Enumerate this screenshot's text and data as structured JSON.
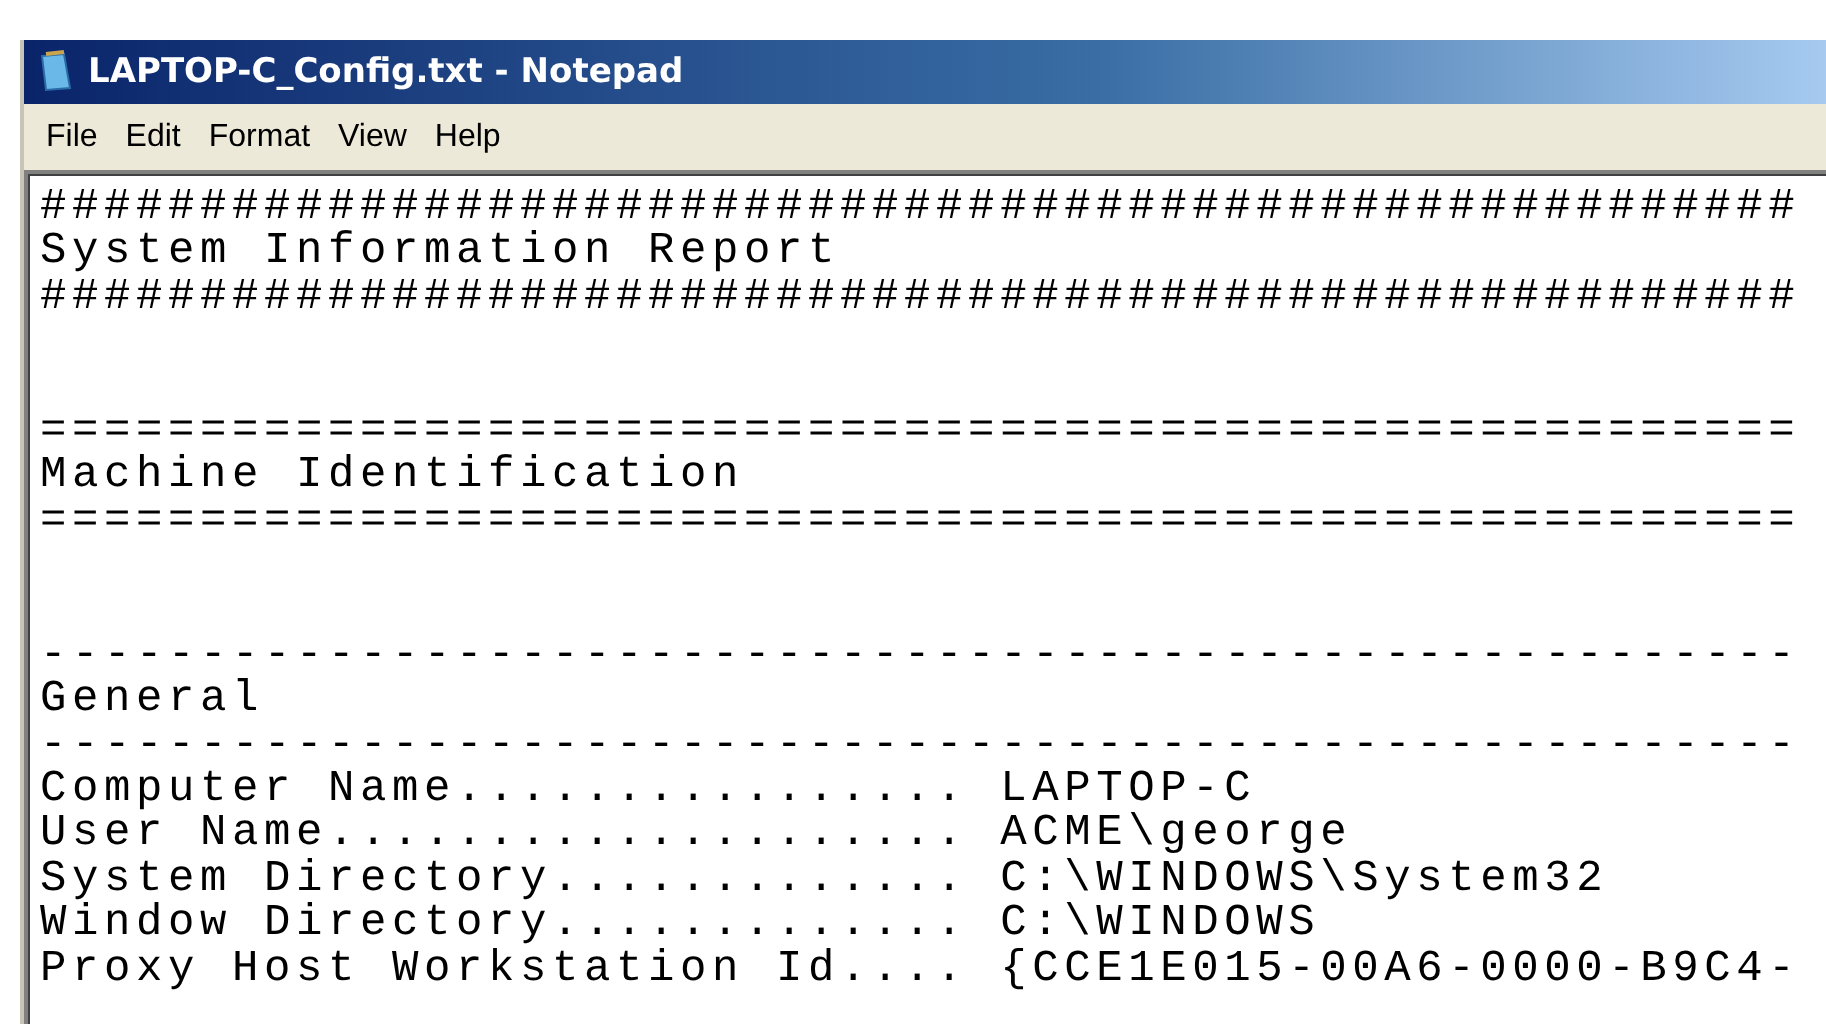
{
  "window": {
    "title": "LAPTOP-C_Config.txt - Notepad"
  },
  "menu": [
    "File",
    "Edit",
    "Format",
    "View",
    "Help"
  ],
  "lines": [
    {
      "kind": "text",
      "text": "#######################################################"
    },
    {
      "kind": "text",
      "text": "System Information Report"
    },
    {
      "kind": "text",
      "text": "#######################################################"
    },
    {
      "kind": "blank"
    },
    {
      "kind": "blank"
    },
    {
      "kind": "text",
      "text": "======================================================="
    },
    {
      "kind": "text",
      "text": "Machine Identification"
    },
    {
      "kind": "text",
      "text": "======================================================="
    },
    {
      "kind": "blank"
    },
    {
      "kind": "blank"
    },
    {
      "kind": "text",
      "text": "-------------------------------------------------------"
    },
    {
      "kind": "text",
      "text": "General"
    },
    {
      "kind": "text",
      "text": "-------------------------------------------------------"
    },
    {
      "kind": "text",
      "text": "Computer Name................ LAPTOP-C"
    },
    {
      "kind": "text",
      "text": "User Name.................... ACME\\george"
    },
    {
      "kind": "text",
      "text": "System Directory............. C:\\WINDOWS\\System32"
    },
    {
      "kind": "text",
      "text": "Window Directory............. C:\\WINDOWS"
    },
    {
      "kind": "text",
      "text": "Proxy Host Workstation Id.... {CCE1E015-00A6-0000-B9C4-"
    }
  ]
}
